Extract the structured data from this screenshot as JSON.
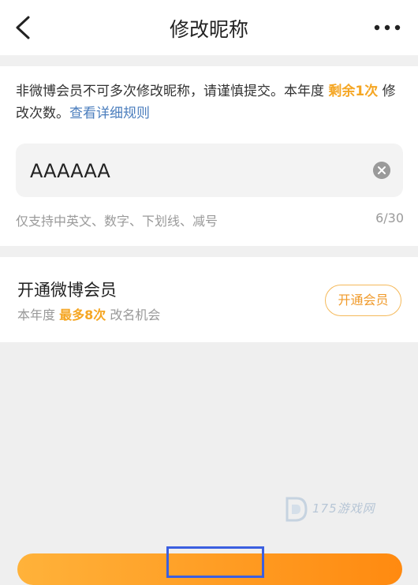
{
  "header": {
    "title": "修改昵称"
  },
  "notice": {
    "text_before": "非微博会员不可多次修改昵称，请谨慎提交。本年度 ",
    "remaining": "剩余1次",
    "text_after": " 修改次数。",
    "rules_link": "查看详细规则"
  },
  "nickname": {
    "value": "AAAAAA",
    "hint": "仅支持中英文、数字、下划线、减号",
    "count": "6/30"
  },
  "vip": {
    "title": "开通微博会员",
    "sub_before": "本年度 ",
    "sub_highlight": "最多8次",
    "sub_after": " 改名机会",
    "button_label": "开通会员"
  },
  "watermark": {
    "text": "175游戏网"
  },
  "colors": {
    "accent": "#f5a623",
    "link": "#4a7dbd",
    "highlight_box": "#3b5fe0"
  }
}
